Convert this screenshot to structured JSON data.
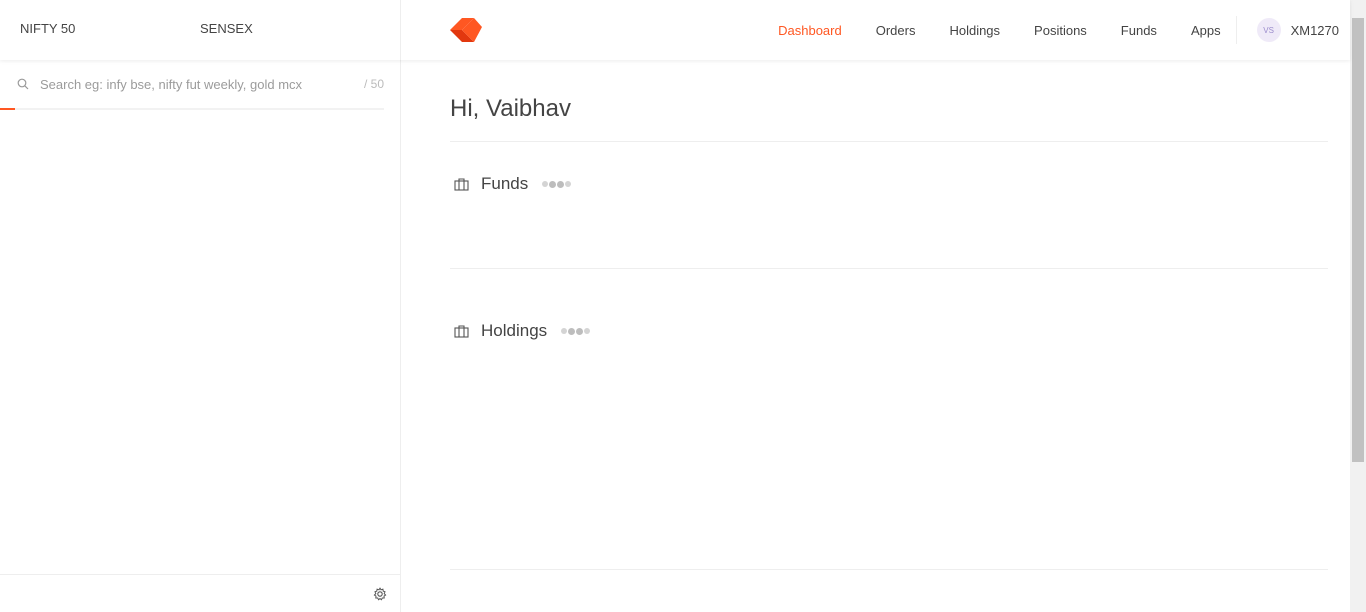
{
  "header": {
    "indices": [
      "NIFTY 50",
      "SENSEX"
    ],
    "logo": "kite-logo",
    "nav": [
      "Dashboard",
      "Orders",
      "Holdings",
      "Positions",
      "Funds",
      "Apps"
    ],
    "active_nav": "Dashboard",
    "user": {
      "avatar_initials": "VS",
      "user_id": "XM1270"
    }
  },
  "sidebar": {
    "search_placeholder": "Search eg: infy bse, nifty fut weekly, gold mcx",
    "search_count": "/ 50",
    "footer_icon": "gear-icon"
  },
  "main": {
    "greeting": "Hi, Vaibhav",
    "sections": [
      {
        "title": "Funds",
        "icon": "briefcase-icon",
        "status": "loading"
      },
      {
        "title": "Holdings",
        "icon": "briefcase-icon",
        "status": "loading"
      }
    ]
  },
  "colors": {
    "accent": "#ff5722",
    "text": "#444444"
  }
}
